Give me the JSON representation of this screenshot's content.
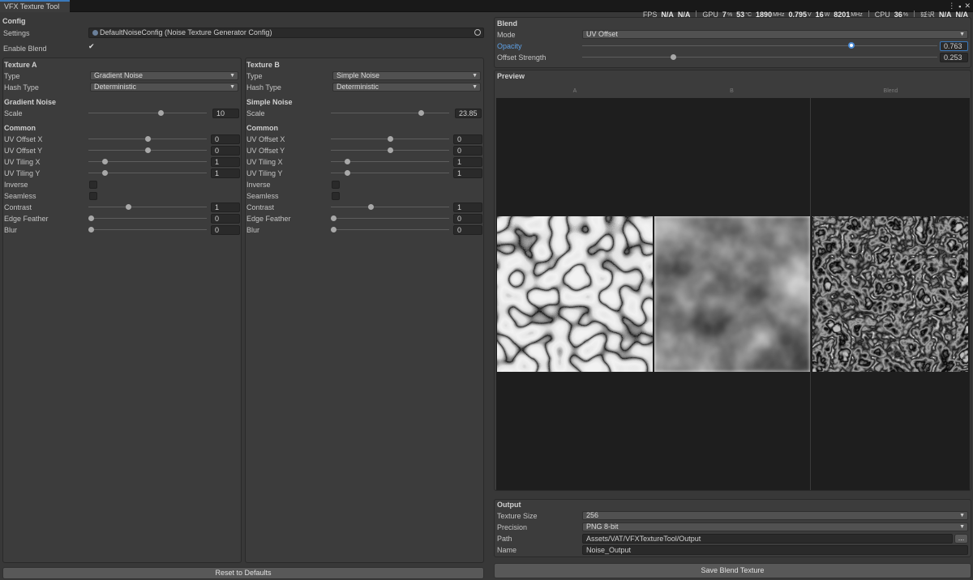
{
  "tab": {
    "title": "VFX Texture Tool"
  },
  "window_icons": [
    "⋮",
    "▪",
    "✕"
  ],
  "perf": {
    "fps_label": "FPS",
    "fps_a": "N/A",
    "fps_b": "N/A",
    "gpu_label": "GPU",
    "gpu_pct": "7",
    "gpu_pct_unit": "%",
    "gpu_temp": "53",
    "gpu_temp_unit": "°C",
    "gpu_clock": "1890",
    "gpu_clock_unit": "MHz",
    "gpu_volt": "0.795",
    "gpu_volt_unit": "V",
    "gpu_power": "16",
    "gpu_power_unit": "W",
    "gpu_mem": "8201",
    "gpu_mem_unit": "MHz",
    "cpu_label": "CPU",
    "cpu_pct": "36",
    "cpu_pct_unit": "%",
    "latency_label": "延迟",
    "latency_a": "N/A",
    "latency_b": "N/A"
  },
  "config": {
    "header": "Config",
    "settings_label": "Settings",
    "settings_value": "DefaultNoiseConfig (Noise Texture Generator Config)",
    "enable_blend_label": "Enable Blend",
    "enable_blend_checked": true
  },
  "texture_a": {
    "header": "Texture A",
    "type_label": "Type",
    "type_value": "Gradient Noise",
    "hash_label": "Hash Type",
    "hash_value": "Deterministic",
    "section_header": "Gradient Noise",
    "scale_label": "Scale",
    "scale_value": "10",
    "scale_fraction": 0.62,
    "common_header": "Common",
    "rows": [
      {
        "label": "UV Offset X",
        "value": "0",
        "fraction": 0.5
      },
      {
        "label": "UV Offset Y",
        "value": "0",
        "fraction": 0.5
      },
      {
        "label": "UV Tiling X",
        "value": "1",
        "fraction": 0.12
      },
      {
        "label": "UV Tiling Y",
        "value": "1",
        "fraction": 0.12
      }
    ],
    "inverse_label": "Inverse",
    "seamless_label": "Seamless",
    "rows2": [
      {
        "label": "Contrast",
        "value": "1",
        "fraction": 0.33
      },
      {
        "label": "Edge Feather",
        "value": "0",
        "fraction": 0.0
      },
      {
        "label": "Blur",
        "value": "0",
        "fraction": 0.0
      }
    ]
  },
  "texture_b": {
    "header": "Texture B",
    "type_label": "Type",
    "type_value": "Simple Noise",
    "hash_label": "Hash Type",
    "hash_value": "Deterministic",
    "section_header": "Simple Noise",
    "scale_label": "Scale",
    "scale_value": "23.85",
    "scale_fraction": 0.78,
    "common_header": "Common",
    "rows": [
      {
        "label": "UV Offset X",
        "value": "0",
        "fraction": 0.5
      },
      {
        "label": "UV Offset Y",
        "value": "0",
        "fraction": 0.5
      },
      {
        "label": "UV Tiling X",
        "value": "1",
        "fraction": 0.12
      },
      {
        "label": "UV Tiling Y",
        "value": "1",
        "fraction": 0.12
      }
    ],
    "inverse_label": "Inverse",
    "seamless_label": "Seamless",
    "rows2": [
      {
        "label": "Contrast",
        "value": "1",
        "fraction": 0.33
      },
      {
        "label": "Edge Feather",
        "value": "0",
        "fraction": 0.0
      },
      {
        "label": "Blur",
        "value": "0",
        "fraction": 0.0
      }
    ]
  },
  "reset_button": "Reset to Defaults",
  "blend": {
    "header": "Blend",
    "mode_label": "Mode",
    "mode_value": "UV Offset",
    "opacity_label": "Opacity",
    "opacity_value": "0.763",
    "opacity_fraction": 0.763,
    "offset_label": "Offset Strength",
    "offset_value": "0.253",
    "offset_fraction": 0.253
  },
  "preview": {
    "header": "Preview",
    "col_a": "A",
    "col_b": "B",
    "col_blend": "Blend"
  },
  "output": {
    "header": "Output",
    "size_label": "Texture Size",
    "size_value": "256",
    "precision_label": "Precision",
    "precision_value": "PNG 8-bit",
    "path_label": "Path",
    "path_value": "Assets/VAT/VFXTextureTool/Output",
    "browse_label": "...",
    "name_label": "Name",
    "name_value": "Noise_Output"
  },
  "save_button": "Save Blend Texture",
  "colors": {
    "accent": "#3a79bb",
    "highlight_label": "#5fa1e6"
  }
}
